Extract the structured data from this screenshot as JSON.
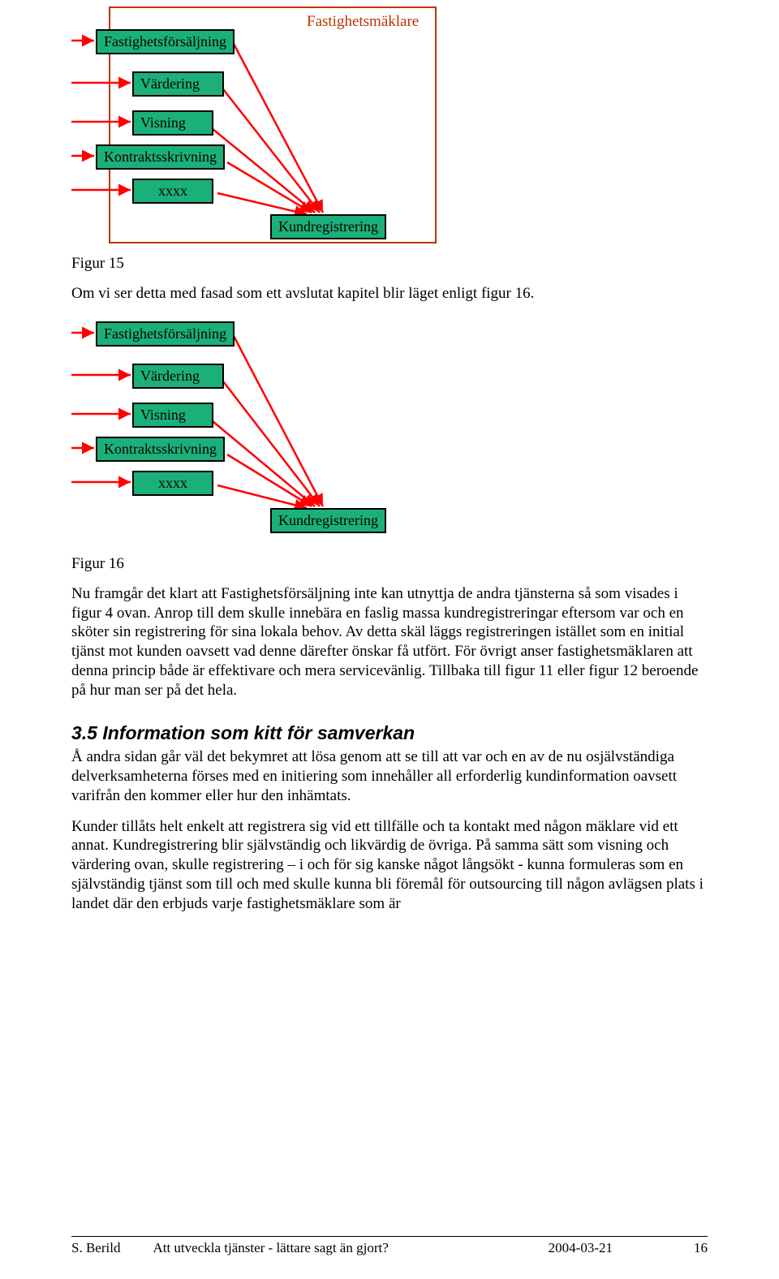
{
  "fig15": {
    "title": "Fastighetsmäklare",
    "boxes": {
      "b1": "Fastighetsförsäljning",
      "b2": "Värdering",
      "b3": "Visning",
      "b4": "Kontraktsskrivning",
      "b5": "xxxx",
      "b6": "Kundregistrering"
    },
    "caption": "Figur 15"
  },
  "para1": "Om vi ser detta med fasad som ett avslutat kapitel blir läget enligt figur 16.",
  "fig16": {
    "boxes": {
      "b1": "Fastighetsförsäljning",
      "b2": "Värdering",
      "b3": "Visning",
      "b4": "Kontraktsskrivning",
      "b5": "xxxx",
      "b6": "Kundregistrering"
    },
    "caption": "Figur 16"
  },
  "para2": "Nu framgår det klart att Fastighetsförsäljning inte kan utnyttja de andra tjänsterna så som visades i figur 4 ovan. Anrop till dem skulle innebära en faslig massa kundregistreringar eftersom var och en sköter sin registrering för sina lokala behov. Av detta skäl läggs registreringen istället som en initial tjänst mot kunden oavsett vad denne därefter önskar få utfört. För övrigt anser fastighetsmäklaren att denna princip både är effektivare och mera servicevänlig. Tillbaka till figur 11 eller figur 12 beroende på hur man ser på det hela.",
  "section": {
    "num": "3.5",
    "title": "Information som kitt för samverkan"
  },
  "para3": "Å andra sidan går väl det bekymret att lösa genom att se till att var och en av de nu osjälvständiga delverksamheterna förses med en initiering som innehåller all erforderlig kundinformation oavsett varifrån den kommer eller hur den inhämtats.",
  "para4": "Kunder tillåts helt enkelt att registrera sig vid ett tillfälle och ta kontakt med någon mäklare vid ett annat. Kundregistrering blir självständig och likvärdig de övriga. På samma sätt som visning och värdering ovan, skulle registrering – i och för sig kanske något långsökt - kunna formuleras som en självständig tjänst som till och med skulle kunna bli föremål för outsourcing till någon avlägsen plats i landet där den erbjuds varje fastighetsmäklare som är",
  "footer": {
    "author": "S. Berild",
    "title": "Att utveckla tjänster - lättare sagt än gjort?",
    "date": "2004-03-21",
    "page": "16"
  }
}
